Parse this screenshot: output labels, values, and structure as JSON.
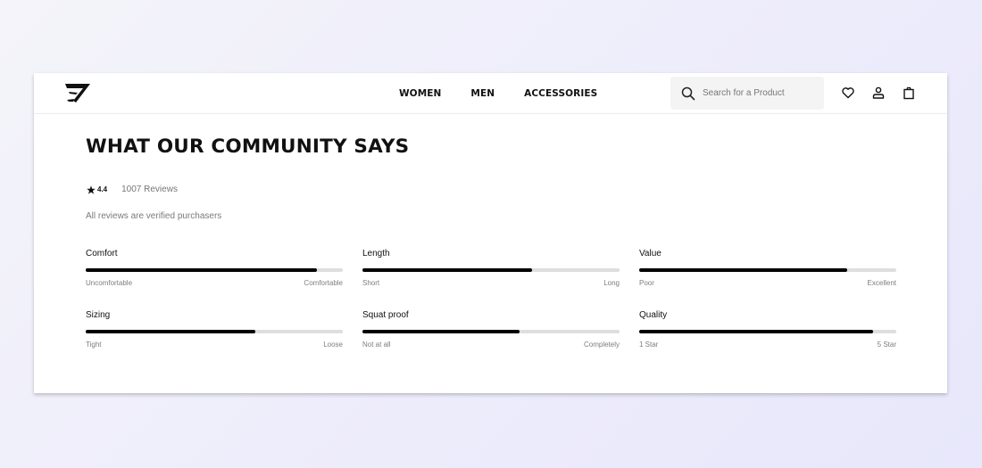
{
  "header": {
    "logo_icon": "gymshark-logo-icon",
    "nav": [
      {
        "label": "WOMEN"
      },
      {
        "label": "MEN"
      },
      {
        "label": "ACCESSORIES"
      }
    ],
    "search": {
      "placeholder": "Search for a Product",
      "value": "",
      "icon": "search-icon"
    },
    "icons": [
      "heart-icon",
      "account-icon",
      "bag-icon"
    ]
  },
  "main": {
    "title": "WHAT OUR COMMUNITY SAYS",
    "rating": {
      "icon": "star-icon",
      "value": "4.4",
      "reviews": "1007 Reviews"
    },
    "verified_text": "All reviews are verified purchasers",
    "metrics": [
      {
        "label": "Comfort",
        "min_label": "Uncomfortable",
        "max_label": "Comfortable",
        "value": 0.9
      },
      {
        "label": "Length",
        "min_label": "Short",
        "max_label": "Long",
        "value": 0.66
      },
      {
        "label": "Value",
        "min_label": "Poor",
        "max_label": "Excellent",
        "value": 0.81
      },
      {
        "label": "Sizing",
        "min_label": "Tight",
        "max_label": "Loose",
        "value": 0.66
      },
      {
        "label": "Squat proof",
        "min_label": "Not at all",
        "max_label": "Completely",
        "value": 0.61
      },
      {
        "label": "Quality",
        "min_label": "1 Star",
        "max_label": "5 Star",
        "value": 0.91
      }
    ]
  },
  "colors": {
    "bar_fill": "#000000",
    "bar_track": "#dedede",
    "background": "#eeedfb"
  }
}
